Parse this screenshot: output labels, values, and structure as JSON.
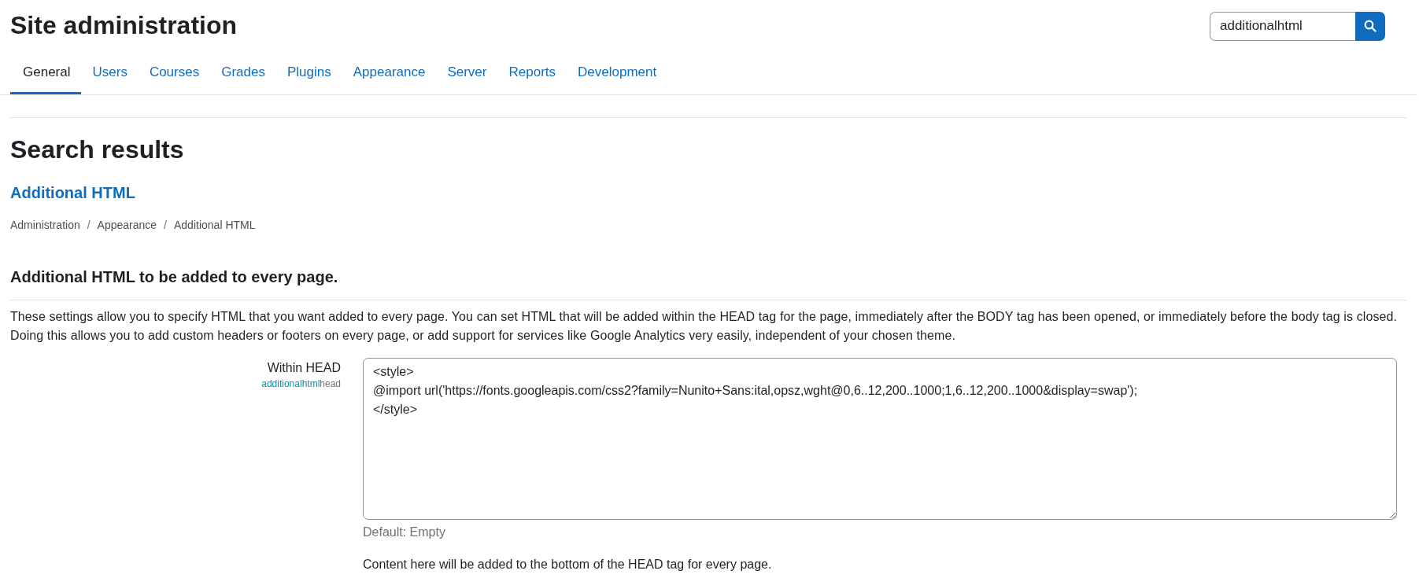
{
  "header": {
    "title": "Site administration"
  },
  "search": {
    "value": "additionalhtml"
  },
  "tabs": [
    {
      "label": "General",
      "selected": true
    },
    {
      "label": "Users",
      "selected": false
    },
    {
      "label": "Courses",
      "selected": false
    },
    {
      "label": "Grades",
      "selected": false
    },
    {
      "label": "Plugins",
      "selected": false
    },
    {
      "label": "Appearance",
      "selected": false
    },
    {
      "label": "Server",
      "selected": false
    },
    {
      "label": "Reports",
      "selected": false
    },
    {
      "label": "Development",
      "selected": false
    }
  ],
  "results": {
    "heading": "Search results",
    "page_link": "Additional HTML",
    "breadcrumb": {
      "items": [
        "Administration",
        "Appearance",
        "Additional HTML"
      ],
      "separator": "/"
    },
    "section_heading": "Additional HTML to be added to every page.",
    "description": "These settings allow you to specify HTML that you want added to every page. You can set HTML that will be added within the HEAD tag for the page, immediately after the BODY tag has been opened, or immediately before the body tag is closed. Doing this allows you to add custom headers or footers on every page, or add support for services like Google Analytics very easily, independent of your chosen theme.",
    "setting": {
      "label": "Within HEAD",
      "name_highlighted": "additionalhtml",
      "name_rest": "head",
      "value": "<style>\n@import url('https://fonts.googleapis.com/css2?family=Nunito+Sans:ital,opsz,wght@0,6..12,200..1000;1,6..12,200..1000&display=swap');\n</style>",
      "default": "Default: Empty",
      "help": "Content here will be added to the bottom of the HEAD tag for every page."
    }
  }
}
